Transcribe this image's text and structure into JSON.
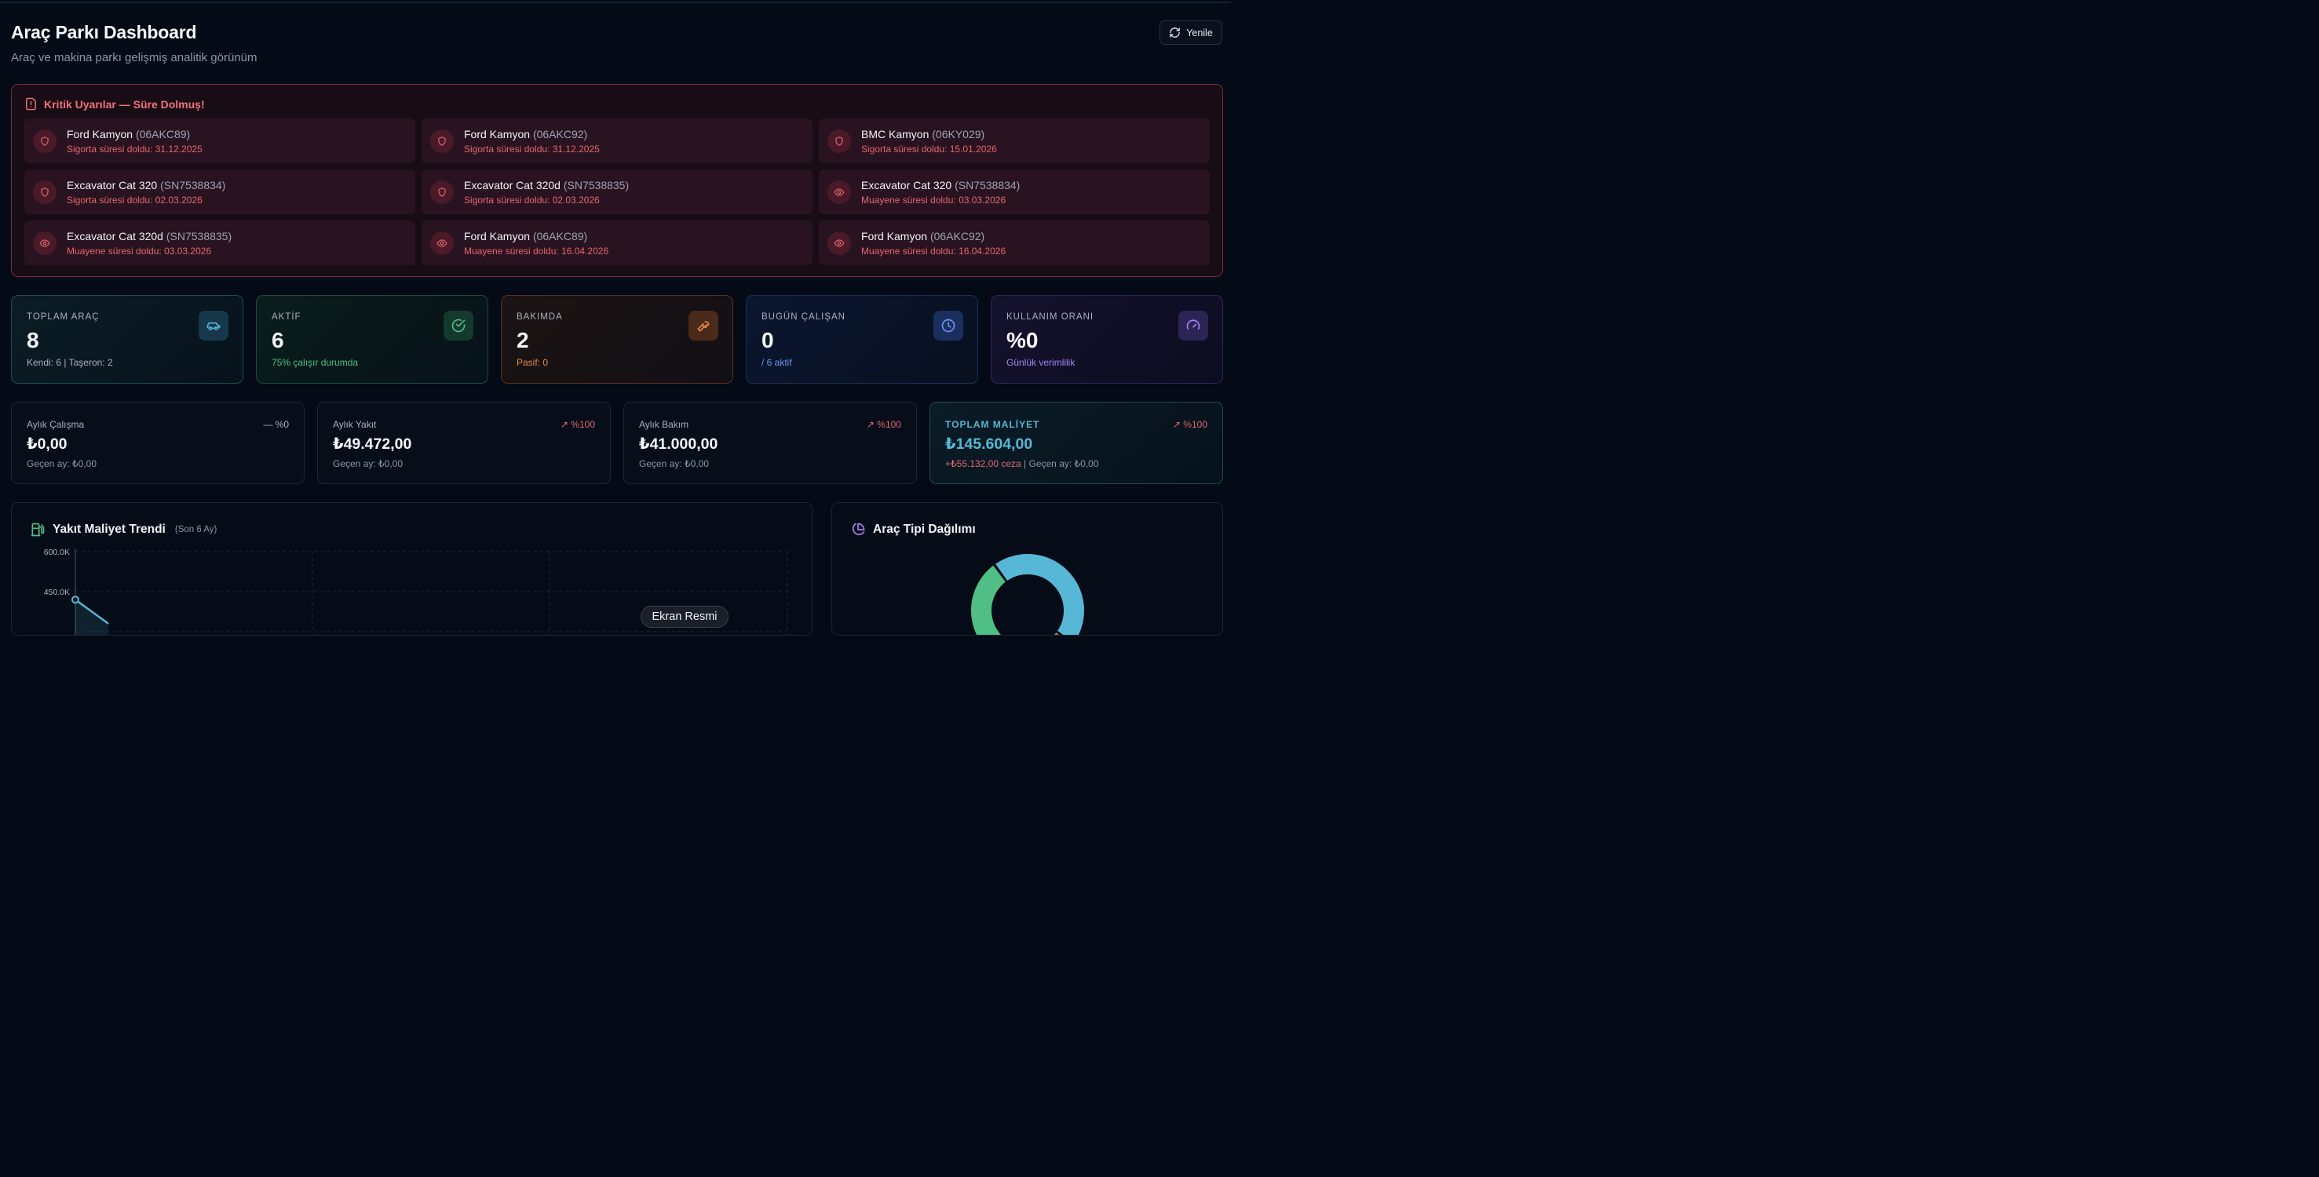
{
  "header": {
    "title": "Araç Parkı Dashboard",
    "subtitle": "Araç ve makina parkı gelişmiş analitik görünüm",
    "refresh_label": "Yenile"
  },
  "alerts": {
    "title": "Kritik Uyarılar — Süre Dolmuş!",
    "items": [
      {
        "name": "Ford Kamyon",
        "plate": "(06AKC89)",
        "detail": "Sigorta süresi doldu: 31.12.2025",
        "icon": "shield-icon"
      },
      {
        "name": "Ford Kamyon",
        "plate": "(06AKC92)",
        "detail": "Sigorta süresi doldu: 31.12.2025",
        "icon": "shield-icon"
      },
      {
        "name": "BMC Kamyon",
        "plate": "(06KY029)",
        "detail": "Sigorta süresi doldu: 15.01.2026",
        "icon": "shield-icon"
      },
      {
        "name": "Excavator Cat 320",
        "plate": "(SN7538834)",
        "detail": "Sigorta süresi doldu: 02.03.2026",
        "icon": "shield-icon"
      },
      {
        "name": "Excavator Cat 320d",
        "plate": "(SN7538835)",
        "detail": "Sigorta süresi doldu: 02.03.2026",
        "icon": "shield-icon"
      },
      {
        "name": "Excavator Cat 320",
        "plate": "(SN7538834)",
        "detail": "Muayene süresi doldu: 03.03.2026",
        "icon": "eye-icon"
      },
      {
        "name": "Excavator Cat 320d",
        "plate": "(SN7538835)",
        "detail": "Muayene süresi doldu: 03.03.2026",
        "icon": "eye-icon"
      },
      {
        "name": "Ford Kamyon",
        "plate": "(06AKC89)",
        "detail": "Muayene süresi doldu: 16.04.2026",
        "icon": "eye-icon"
      },
      {
        "name": "Ford Kamyon",
        "plate": "(06AKC92)",
        "detail": "Muayene süresi doldu: 16.04.2026",
        "icon": "eye-icon"
      }
    ]
  },
  "stats": [
    {
      "label": "TOPLAM ARAÇ",
      "value": "8",
      "sub": "Kendi: 6 | Taşeron: 2",
      "icon": "car-icon"
    },
    {
      "label": "AKTİF",
      "value": "6",
      "sub": "75% çalışır durumda",
      "icon": "check-circle-icon"
    },
    {
      "label": "BAKIMDA",
      "value": "2",
      "sub": "Pasif: 0",
      "icon": "wrench-icon"
    },
    {
      "label": "BUGÜN ÇALIŞAN",
      "value": "0",
      "sub": "/ 6 aktif",
      "icon": "clock-icon"
    },
    {
      "label": "KULLANIM ORANI",
      "value": "%0",
      "sub": "Günlük verimlilik",
      "icon": "gauge-icon"
    }
  ],
  "money": [
    {
      "label": "Aylık Çalışma",
      "trend": "— %0",
      "value": "₺0,00",
      "sub": "Geçen ay: ₺0,00"
    },
    {
      "label": "Aylık Yakıt",
      "trend": "↗ %100",
      "value": "₺49.472,00",
      "sub": "Geçen ay: ₺0,00"
    },
    {
      "label": "Aylık Bakım",
      "trend": "↗ %100",
      "value": "₺41.000,00",
      "sub": "Geçen ay: ₺0,00"
    },
    {
      "label": "TOPLAM MALİYET",
      "trend": "↗ %100",
      "value": "₺145.604,00",
      "sub_penalty": "+₺55.132,00 ceza",
      "sub_rest": " | Geçen ay: ₺0,00"
    }
  ],
  "fuel_panel": {
    "title": "Yakıt Maliyet Trendi",
    "note": "(Son 6 Ay)"
  },
  "type_panel": {
    "title": "Araç Tipi Dağılımı"
  },
  "colors": {
    "accent_cyan": "#56b8d6",
    "danger": "#e4666f",
    "success": "#4fbf85",
    "warning": "#e0894a",
    "info": "#6f93f0",
    "purple": "#a584f0"
  },
  "overlay": {
    "label": "Ekran Resmi"
  },
  "chart_data": [
    {
      "type": "line",
      "title": "Yakıt Maliyet Trendi",
      "subtitle": "(Son 6 Ay)",
      "y_ticks": [
        "600.0K",
        "450.0K"
      ],
      "ylim": [
        0,
        600000
      ],
      "x": [
        0,
        1
      ],
      "series": [
        {
          "values": [
            420000,
            330000
          ]
        }
      ],
      "grid": true
    },
    {
      "type": "pie",
      "title": "Araç Tipi Dağılımı",
      "slices": [
        {
          "value": 45,
          "color": "#56b8d6"
        },
        {
          "value": 22,
          "color": "#e4666f"
        },
        {
          "value": 33,
          "color": "#4fbf85"
        }
      ]
    }
  ]
}
